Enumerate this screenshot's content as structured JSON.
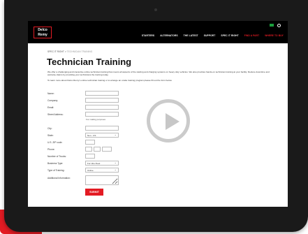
{
  "logo": {
    "line1": "Delco",
    "line2": "Remy"
  },
  "nav": {
    "items": [
      "STARTERS",
      "ALTERNATORS",
      "THE LATEST",
      "SUPPORT",
      "SPEC IT RIGHT"
    ],
    "accent_items": [
      "FIND A PART",
      "WHERE TO BUY"
    ]
  },
  "breadcrumb": {
    "parent": "SPEC IT RIGHT",
    "sep": ">",
    "current": "TECHNICIAN TRAINING"
  },
  "page": {
    "title": "Technician Training",
    "intro1": "We offer a challenging and interactive online technician training that covers all aspects of the starting and charging systems on heavy duty vehicles. We also provides hands-on technician training at your facility. Reduce downtime and warranty claims by providing your technicians the training today.",
    "intro2": "To learn more about Delco Remy's online technician training or to arrange an onsite training program please fill out the form below."
  },
  "form": {
    "name": "Name:",
    "company": "Company:",
    "email": "Email:",
    "street": "Street Address:",
    "street_hint": "For mailing purposes",
    "city": "City:",
    "state": "State:",
    "state_value": "Non - US",
    "zip": "U.S. ZIP code:",
    "phone": "Phone:",
    "trucks": "Number of Trucks:",
    "business": "Business Type:",
    "business_value": "For Hire Fleet",
    "training": "Type of Training:",
    "training_value": "Online",
    "additional": "Additional Information:",
    "submit": "SUBMIT"
  },
  "colors": {
    "accent": "#e31b23",
    "header": "#000000"
  },
  "icons": {
    "play": "play-icon",
    "flag": "flag-icon",
    "user": "user-icon"
  }
}
